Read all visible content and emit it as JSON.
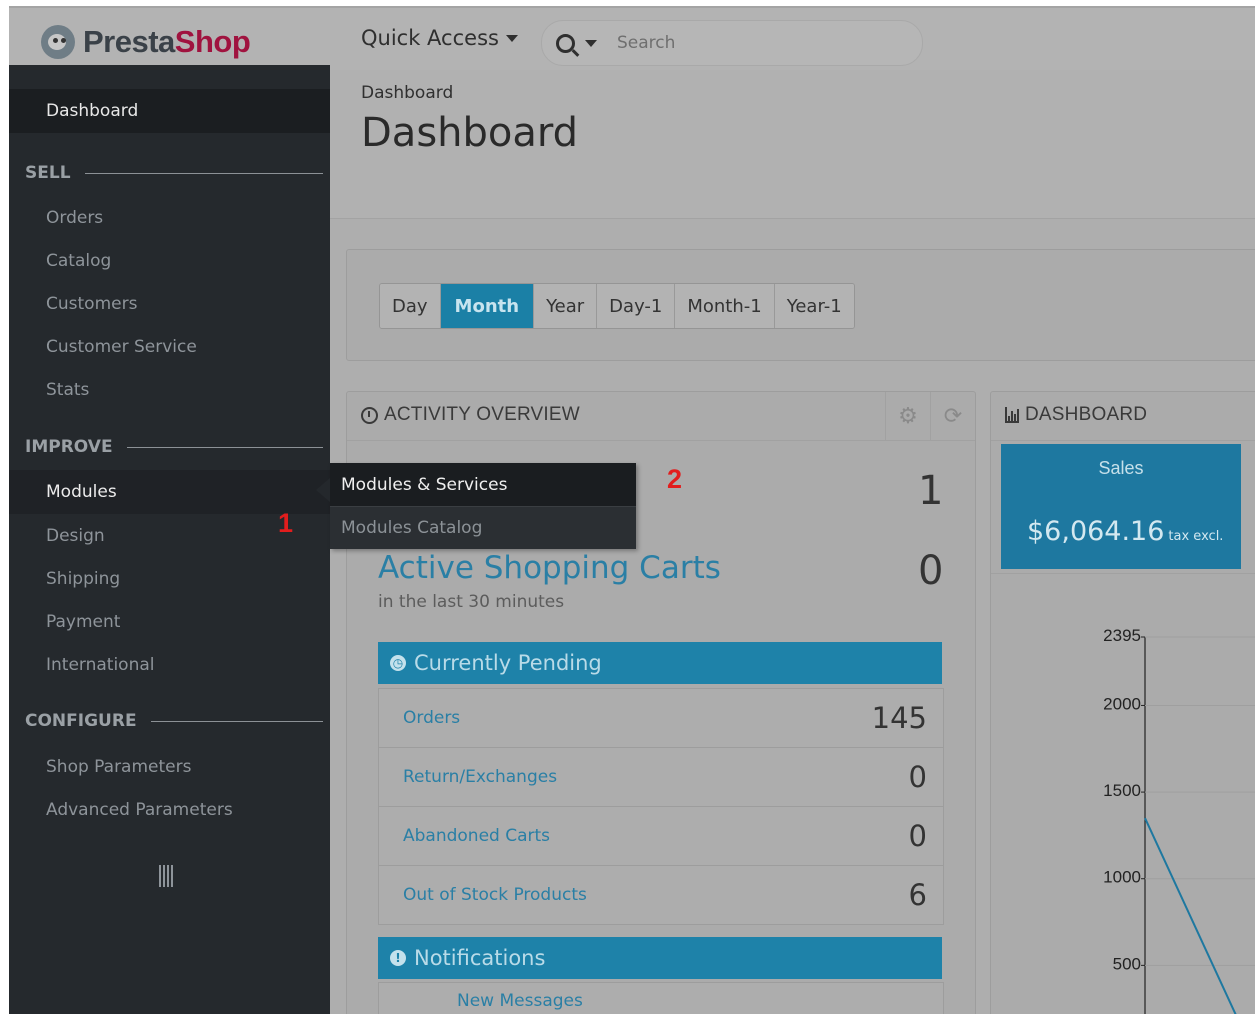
{
  "header": {
    "logo_part1": "Presta",
    "logo_part2": "Shop",
    "quick_access": "Quick Access",
    "search_placeholder": "Search"
  },
  "sidebar": {
    "dashboard": "Dashboard",
    "sections": [
      {
        "title": "SELL",
        "items": [
          "Orders",
          "Catalog",
          "Customers",
          "Customer Service",
          "Stats"
        ]
      },
      {
        "title": "IMPROVE",
        "items": [
          "Modules",
          "Design",
          "Shipping",
          "Payment",
          "International"
        ]
      },
      {
        "title": "CONFIGURE",
        "items": [
          "Shop Parameters",
          "Advanced Parameters"
        ]
      }
    ]
  },
  "submenu": {
    "items": [
      "Modules & Services",
      "Modules Catalog"
    ]
  },
  "annotations": [
    "1",
    "2"
  ],
  "page": {
    "breadcrumb": "Dashboard",
    "title": "Dashboard"
  },
  "period_buttons": [
    "Day",
    "Month",
    "Year",
    "Day-1",
    "Month-1",
    "Year-1"
  ],
  "period_active": "Month",
  "activity": {
    "title": "ACTIVITY OVERVIEW",
    "online_count": "1",
    "active_carts_label": "Active Shopping Carts",
    "active_carts_value": "0",
    "active_carts_sub": "in the last 30 minutes",
    "pending_title": "Currently Pending",
    "pending": [
      {
        "label": "Orders",
        "value": "145"
      },
      {
        "label": "Return/Exchanges",
        "value": "0"
      },
      {
        "label": "Abandoned Carts",
        "value": "0"
      },
      {
        "label": "Out of Stock Products",
        "value": "6"
      }
    ],
    "notifications_title": "Notifications",
    "notifications_first": "New Messages"
  },
  "dashboard_panel": {
    "title": "DASHBOARD",
    "sales_title": "Sales",
    "sales_value": "$6,064.16",
    "sales_tax": "tax excl."
  },
  "chart_data": {
    "type": "line",
    "y_ticks": [
      2395,
      2000,
      1500,
      1000,
      500
    ],
    "ylim": [
      0,
      2395
    ],
    "series": [
      {
        "values": [
          1350,
          0
        ]
      }
    ],
    "line_color": "#1e78a0",
    "grid": true
  },
  "colors": {
    "accent": "#1e82a9",
    "sidebar_bg": "#25292d",
    "annotation_red": "#e21d1d"
  }
}
